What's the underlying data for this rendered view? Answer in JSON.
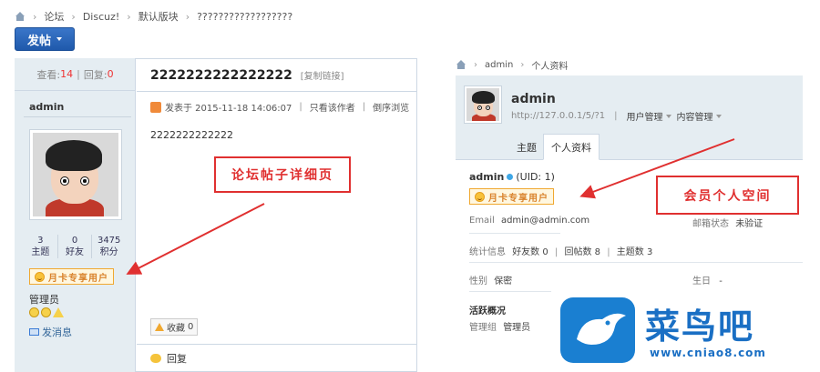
{
  "forum": {
    "breadcrumb": [
      "论坛",
      "Discuz!",
      "默认版块",
      "??????????????????"
    ],
    "post_button": "发帖",
    "stats": {
      "views_label": "查看:",
      "views": "14",
      "replies_label": "回复:",
      "replies": "0"
    },
    "author": "admin",
    "author_stats": [
      {
        "value": "3",
        "label": "主题"
      },
      {
        "value": "0",
        "label": "好友"
      },
      {
        "value": "3475",
        "label": "积分"
      }
    ],
    "badge": "月卡专享用户",
    "role": "管理员",
    "send_message": "发消息",
    "post_title": "2222222222222222",
    "edit_title": "[复制链接]",
    "meta_posted": "发表于 2015-11-18 14:06:07",
    "meta_author_only": "只看该作者",
    "meta_reverse": "倒序浏览",
    "body": "2222222222222",
    "favorite": "收藏",
    "favorite_count": "0",
    "reply": "回复"
  },
  "annotations": {
    "forum_detail": "论坛帖子详细页",
    "member_space": "会员个人空间"
  },
  "profile": {
    "breadcrumb": [
      "admin",
      "个人资料"
    ],
    "name": "admin",
    "url": "http://127.0.0.1/5/?1",
    "menu_user": "用户管理",
    "menu_content": "内容管理",
    "tabs": [
      "主题",
      "个人资料"
    ],
    "username": "admin",
    "uid": "(UID: 1)",
    "badge": "月卡专享用户",
    "email_label": "Email",
    "email": "admin@admin.com",
    "email_status_label": "邮箱状态",
    "email_status": "未验证",
    "stats_label": "统计信息",
    "stats_friends": "好友数 0",
    "stats_replies": "回帖数 8",
    "stats_topics": "主题数 3",
    "gender_label": "性别",
    "gender": "保密",
    "birthday_label": "生日",
    "birthday": "-",
    "activity_title": "活跃概况",
    "group_label": "管理组",
    "group": "管理员"
  },
  "watermark": {
    "name": "菜鸟吧",
    "url": "www.cniao8.com"
  },
  "colors": {
    "accent": "#1f59ab",
    "annotation": "#e03030",
    "sidebar_bg": "#e5edf2",
    "logo": "#1a7fd1"
  }
}
